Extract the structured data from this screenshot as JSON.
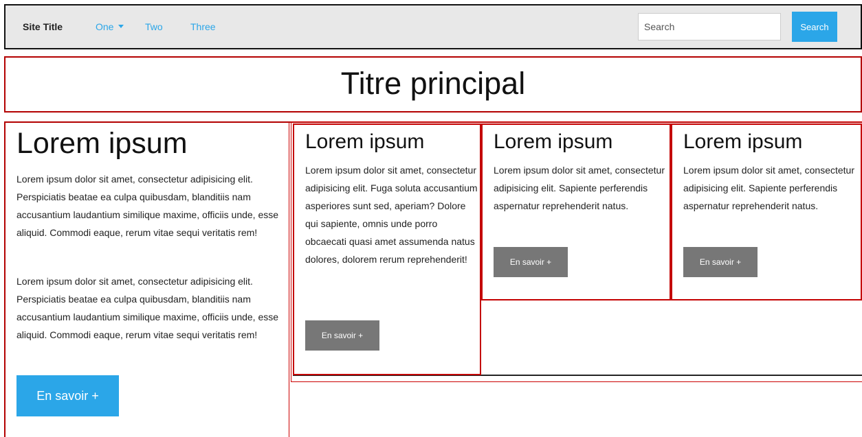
{
  "navbar": {
    "site_title": "Site Title",
    "links": [
      {
        "label": "One",
        "has_dropdown": true
      },
      {
        "label": "Two"
      },
      {
        "label": "Three"
      }
    ],
    "search": {
      "placeholder": "Search",
      "value": "",
      "button_label": "Search"
    }
  },
  "main_title": "Titre principal",
  "left_column": {
    "heading": "Lorem ipsum",
    "paragraphs": [
      "Lorem ipsum dolor sit amet, consectetur adipisicing elit. Perspiciatis beatae ea culpa quibusdam, blanditiis nam accusantium laudantium similique maxime, officiis unde, esse aliquid. Commodi eaque, rerum vitae sequi veritatis rem!",
      "Lorem ipsum dolor sit amet, consectetur adipisicing elit. Perspiciatis beatae ea culpa quibusdam, blanditiis nam accusantium laudantium similique maxime, officiis unde, esse aliquid. Commodi eaque, rerum vitae sequi veritatis rem!"
    ],
    "button_label": "En savoir +"
  },
  "cards": [
    {
      "heading": "Lorem ipsum",
      "text": "Lorem ipsum dolor sit amet, consectetur adipisicing elit. Fuga soluta accusantium asperiores sunt sed, aperiam? Dolore qui sapiente, omnis unde porro obcaecati quasi amet assumenda natus dolores, dolorem rerum reprehenderit!",
      "button_label": "En savoir +"
    },
    {
      "heading": "Lorem ipsum",
      "text": "Lorem ipsum dolor sit amet, consectetur adipisicing elit. Sapiente perferendis aspernatur reprehenderit natus.",
      "button_label": "En savoir +"
    },
    {
      "heading": "Lorem ipsum",
      "text": "Lorem ipsum dolor sit amet, consectetur adipisicing elit. Sapiente perferendis aspernatur reprehenderit natus.",
      "button_label": "En savoir +"
    }
  ],
  "colors": {
    "accent": "#2ba6e8",
    "outline_red": "#c40000",
    "secondary_button": "#777777",
    "navbar_bg": "#e8e8e8"
  }
}
